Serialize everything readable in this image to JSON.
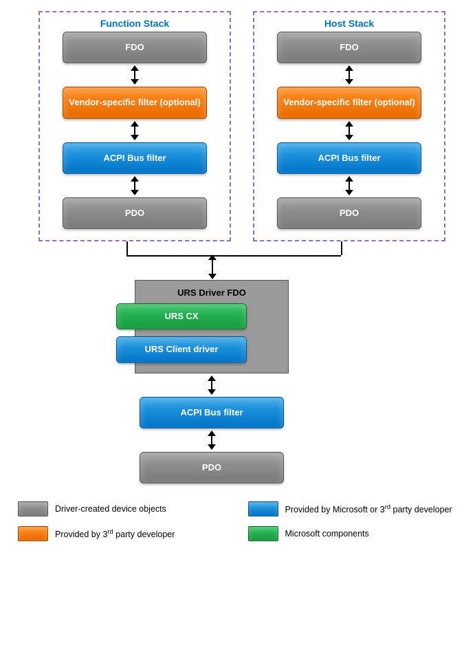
{
  "stacks": {
    "function": {
      "title": "Function Stack",
      "fdo": "FDO",
      "vendor_filter": "Vendor-specific filter (optional)",
      "acpi": "ACPI Bus filter",
      "pdo": "PDO"
    },
    "host": {
      "title": "Host Stack",
      "fdo": "FDO",
      "vendor_filter": "Vendor-specific filter (optional)",
      "acpi": "ACPI Bus filter",
      "pdo": "PDO"
    }
  },
  "urs": {
    "box_title": "URS Driver FDO",
    "cx": "URS CX",
    "client": "URS Client driver"
  },
  "lower": {
    "acpi": "ACPI Bus filter",
    "pdo": "PDO"
  },
  "legend": {
    "gray": "Driver-created device objects",
    "blue_html": "Provided by Microsoft or 3<sup>rd</sup> party developer",
    "orange_html": "Provided by 3<sup>rd</sup> party developer",
    "green": "Microsoft components"
  },
  "colors": {
    "gray": "#8b8b8b",
    "orange": "#f27a00",
    "blue": "#0f87d2",
    "green": "#1fad4b",
    "dash_border": "#8a6fd3",
    "title_blue": "#0072c6"
  }
}
